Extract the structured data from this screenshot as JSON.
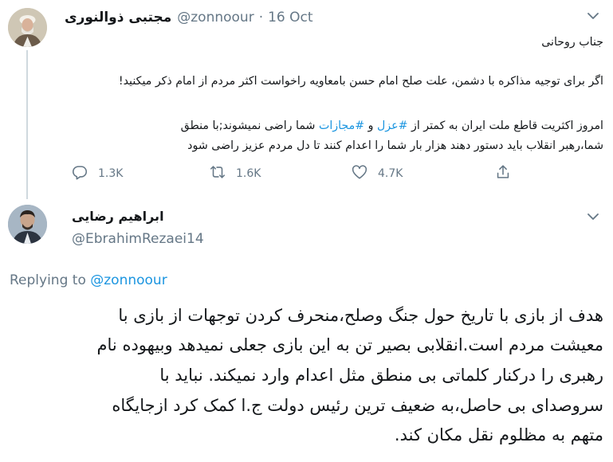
{
  "tweet": {
    "author_name": "مجتبی ذوالنوری",
    "handle": "@zonnoour",
    "separator": "·",
    "date": "16 Oct",
    "lines": {
      "l1": "جناب روحانی",
      "l2": "اگر برای توجیه مذاکره با دشمن، علت صلح امام حسن بامعاویه راخواست اکثر مردم از امام ذکر میکنید!",
      "l3_before": "امروز اکثریت قاطع ملت ایران به کمتر از",
      "l3_tag1": "#عزل",
      "l3_mid": "و",
      "l3_tag2": "#مجازات",
      "l3_after": "شما راضی نمیشوند;با منطق",
      "l4": "شما،رهبر انقلاب باید دستور دهند هزار بار شما را اعدام کنند تا دل مردم عزیز راضی شود"
    },
    "actions": {
      "replies": "1.3K",
      "retweets": "1.6K",
      "likes": "4.7K"
    }
  },
  "reply": {
    "author_name": "ابراهیم رضایی",
    "handle": "@EbrahimRezaei14",
    "replying_label": "Replying to",
    "replying_to": "@zonnoour",
    "lines": {
      "b1": "هدف از بازی با تاریخ حول جنگ وصلح،منحرف کردن توجهات از بازی با",
      "b2": "معیشت مردم است.انقلابی بصیر تن به این بازی جعلی نمیدهد وبیهوده نام",
      "b3": "رهبری را درکنار کلماتی بی منطق مثل اعدام وارد نمیکند. نباید با",
      "b4": "سروصدای بی حاصل،به ضعیف ترین رئیس دولت ج.ا کمک کرد ازجایگاه",
      "b5": "متهم به مظلوم نقل مکان کند."
    }
  },
  "colors": {
    "text": "#14171a",
    "secondary": "#657786",
    "link": "#1b95e0",
    "thread_line": "#cfd9de"
  },
  "icons": {
    "reply": "reply-icon",
    "retweet": "retweet-icon",
    "like": "heart-icon",
    "share": "share-icon",
    "caret": "chevron-down-icon"
  }
}
